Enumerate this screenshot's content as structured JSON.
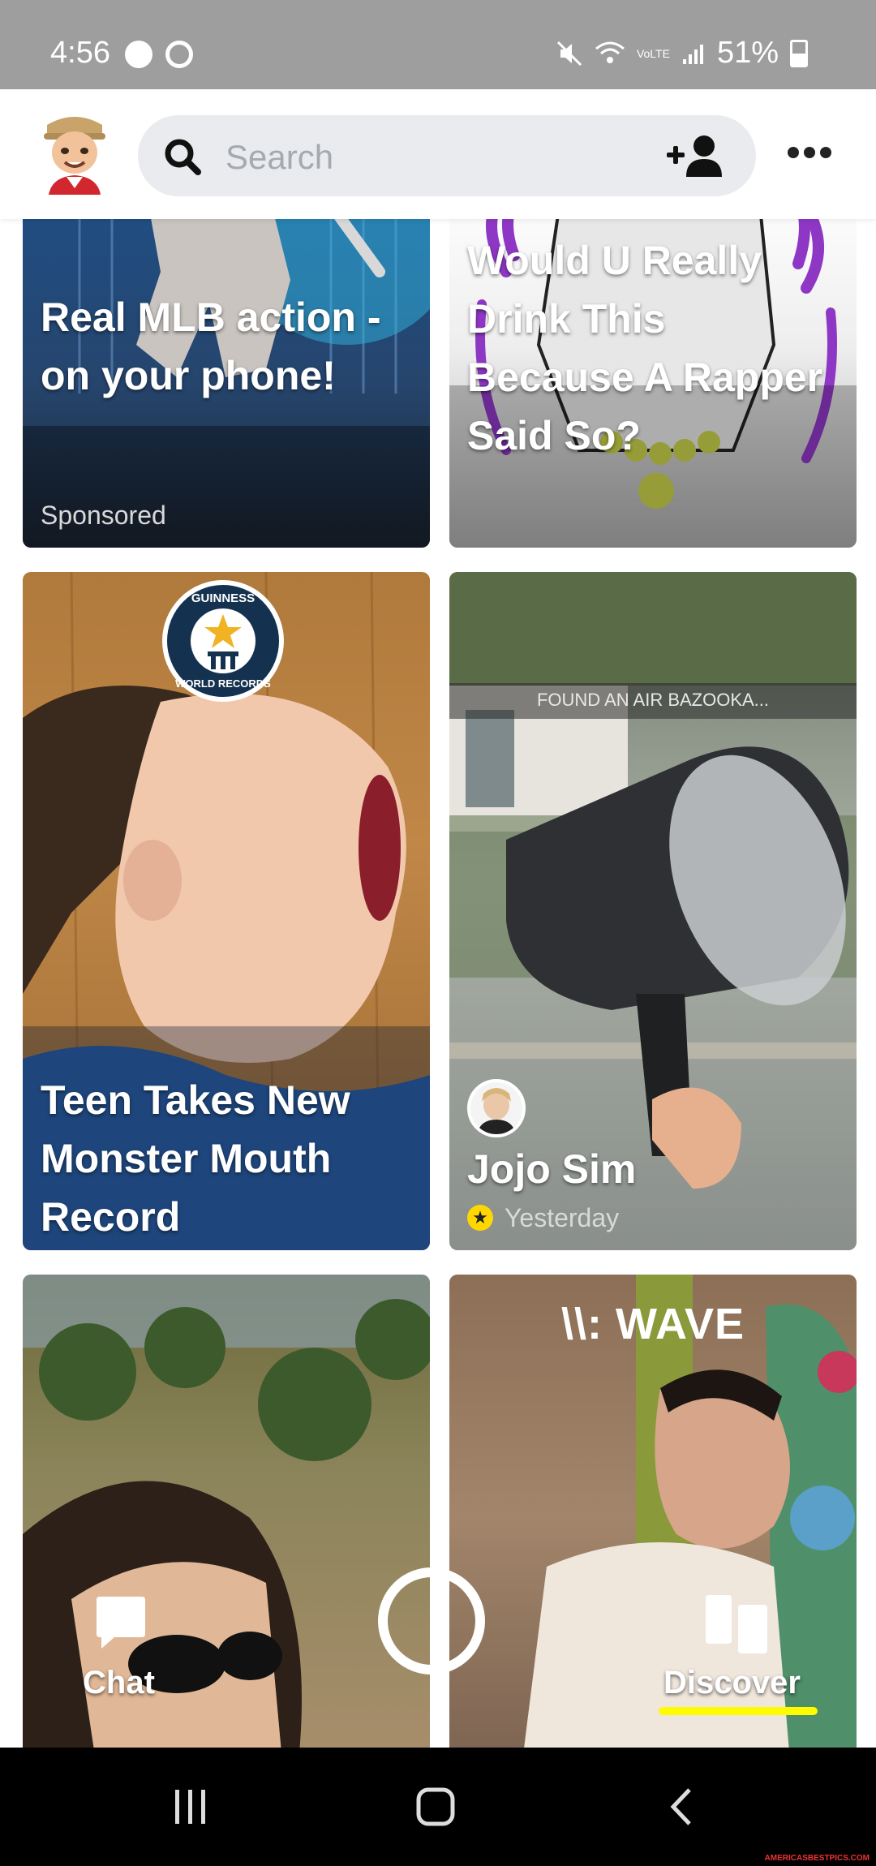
{
  "status_bar": {
    "time": "4:56",
    "volte": "VoLTE",
    "battery": "51%"
  },
  "header": {
    "search": {
      "placeholder": "Search"
    }
  },
  "tiles": [
    {
      "title_lines": [
        "Real MLB action -",
        "on your phone!"
      ],
      "subtitle": "Sponsored"
    },
    {
      "title_lines": [
        "Would U Really",
        "Drink This",
        "Because A Rapper",
        "Said So?"
      ]
    },
    {
      "title_lines": [
        "Teen Takes New",
        "Monster Mouth",
        "Record"
      ],
      "badge": [
        "GUINNESS",
        "WORLD RECORDS"
      ]
    },
    {
      "banner": "FOUND AN AIR BAZOOKA...",
      "creator": "Jojo Sim",
      "time": "Yesterday"
    },
    {},
    {
      "brand": "\\\\: WAVE"
    }
  ],
  "bottom_nav": {
    "chat_label": "Chat",
    "discover_label": "Discover"
  },
  "colors": {
    "accent_yellow": "#fffc00",
    "status_bar": "#9e9e9e",
    "search_bg": "#e9ebee"
  },
  "watermark": "AMERICASBESTPICS.COM"
}
